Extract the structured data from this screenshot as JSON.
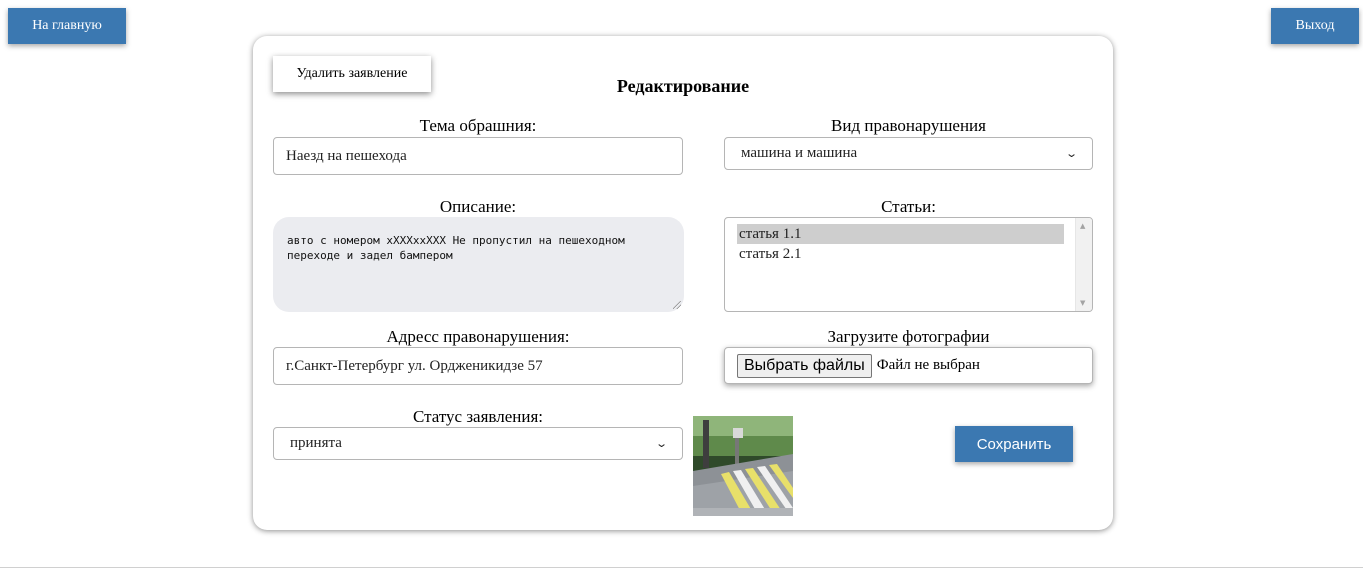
{
  "nav": {
    "home_label": "На главную",
    "logout_label": "Выход"
  },
  "form": {
    "delete_label": "Удалить заявление",
    "title": "Редактирование",
    "subject": {
      "label": "Тема обрашния:",
      "value": "Наезд на пешехода"
    },
    "violation_type": {
      "label": "Вид правонарушения",
      "selected": "машина и машина"
    },
    "description": {
      "label": "Описание:",
      "value": "авто с номером хXXXхxXXX Не пропустил на пешеходном переходе и задел бампером"
    },
    "articles": {
      "label": "Статьи:",
      "items": [
        {
          "label": "статья 1.1",
          "selected": true
        },
        {
          "label": "статья 2.1",
          "selected": false
        }
      ]
    },
    "address": {
      "label": "Адресс правонарушения:",
      "value": "г.Санкт-Петербург ул. Ордженикидзе 57"
    },
    "upload": {
      "label": "Загрузите фотографии",
      "button_label": "Выбрать файлы",
      "status": "Файл не выбран"
    },
    "status": {
      "label": "Статус заявления:",
      "selected": "принята"
    },
    "save_label": "Сохранить"
  },
  "colors": {
    "accent": "#3b78b1",
    "textarea_bg": "#ebecf0",
    "selected_item_bg": "#cecece"
  },
  "icons": {
    "select_arrow": "chevron-down-icon",
    "photo": "crosswalk-photo"
  }
}
